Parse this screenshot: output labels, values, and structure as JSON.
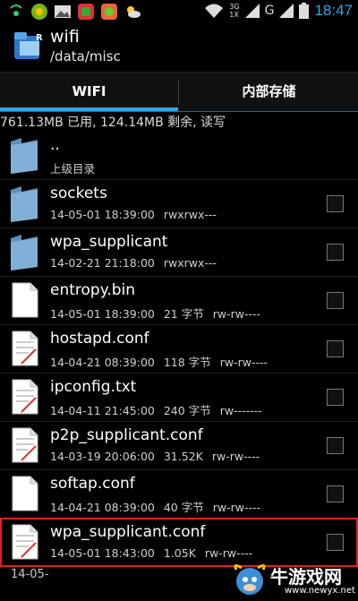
{
  "status_bar": {
    "time": "18:47",
    "network_type": "3G",
    "network_label": "1X",
    "data_label": "G",
    "notification_icons": [
      "signal-icon",
      "game-icon",
      "image-icon",
      "app-icon",
      "app2-icon",
      "weather-icon"
    ],
    "accent_color": "#2fa7e3"
  },
  "header": {
    "title": "wifi",
    "path": "/data/misc"
  },
  "tabs": [
    {
      "label": "WIFI",
      "active": true
    },
    {
      "label": "内部存储",
      "active": false
    }
  ],
  "storage_info": "761.13MB 已用, 124.14MB 剩余, 读写",
  "files": [
    {
      "name": "..",
      "meta": [
        "上级目录"
      ],
      "type": "folder",
      "checkbox": false
    },
    {
      "name": "sockets",
      "meta": [
        "14-05-01 18:39:00",
        "rwxrwx---"
      ],
      "type": "folder",
      "checkbox": true
    },
    {
      "name": "wpa_supplicant",
      "meta": [
        "14-02-21 21:18:00",
        "rwxrwx---"
      ],
      "type": "folder",
      "checkbox": true
    },
    {
      "name": "entropy.bin",
      "meta": [
        "14-05-01 18:39:00",
        "21 字节",
        "rw-rw----"
      ],
      "type": "file",
      "checkbox": true
    },
    {
      "name": "hostapd.conf",
      "meta": [
        "14-04-21 08:39:00",
        "118 字节",
        "rw-rw----"
      ],
      "type": "text",
      "checkbox": true
    },
    {
      "name": "ipconfig.txt",
      "meta": [
        "14-04-11 21:45:00",
        "240 字节",
        "rw-------"
      ],
      "type": "text",
      "checkbox": true
    },
    {
      "name": "p2p_supplicant.conf",
      "meta": [
        "14-03-19 20:06:00",
        "31.52K",
        "rw-rw----"
      ],
      "type": "text",
      "checkbox": true
    },
    {
      "name": "softap.conf",
      "meta": [
        "14-04-21 08:39:00",
        "40 字节",
        "rw-rw----"
      ],
      "type": "text",
      "checkbox": true
    },
    {
      "name": "wpa_supplicant.conf",
      "meta": [
        "14-05-01 18:43:00",
        "1.05K",
        "rw-rw----"
      ],
      "type": "text",
      "checkbox": true,
      "selected": true
    }
  ],
  "overlap_text": "14-05-",
  "watermark": {
    "text": "牛游戏网",
    "url": "www.newyx.net"
  }
}
